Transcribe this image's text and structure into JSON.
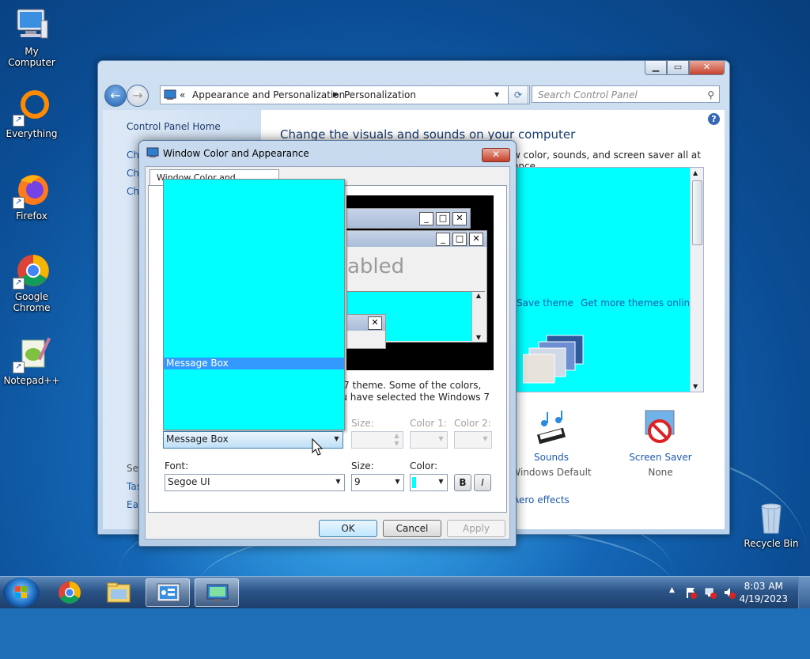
{
  "desktop_icons": [
    {
      "label": "My Computer",
      "icon": "computer-icon"
    },
    {
      "label": "Everything",
      "icon": "everything-icon"
    },
    {
      "label": "Firefox",
      "icon": "firefox-icon"
    },
    {
      "label_line1": "Google",
      "label_line2": "Chrome",
      "icon": "chrome-icon"
    },
    {
      "label": "Notepad++",
      "icon": "notepadpp-icon"
    },
    {
      "label": "Recycle Bin",
      "icon": "recycle-bin-icon"
    }
  ],
  "control_panel": {
    "breadcrumb_prefix": "«",
    "breadcrumb": [
      "Appearance and Personalization",
      "Personalization"
    ],
    "search_placeholder": "Search Control Panel",
    "left_home": "Control Panel Home",
    "left_links_partial": [
      "Ch",
      "Ch",
      "Ch"
    ],
    "see_also_partial": "See",
    "see_also_links_partial": [
      "Tas",
      "Eas"
    ],
    "heading": "Change the visuals and sounds on your computer",
    "subtext_partial": "w color, sounds, and screen saver all at once.",
    "save_theme": "Save theme",
    "get_more_themes": "Get more themes online",
    "sounds_label": "Sounds",
    "sounds_value": "Windows Default",
    "screensaver_label": "Screen Saver",
    "screensaver_value": "None",
    "aero_effects": "Aero effects"
  },
  "dialog": {
    "title": "Window Color and Appearance",
    "tab": "Window Color and Appearance",
    "preview": {
      "inactive_text_partial": "abled",
      "close_glyph": "✕",
      "min_glyph": "_",
      "max_glyph": "□"
    },
    "theme_text_line1": "s 7 theme.  Some of the colors,",
    "theme_text_line2": "ou have selected the Windows 7",
    "item_list_selected": "Message Box",
    "item_combo_value": "Message Box",
    "size_label_top": "Size:",
    "color1_label": "Color 1:",
    "color2_label": "Color 2:",
    "font_label": "Font:",
    "font_value": "Segoe UI",
    "font_size_label": "Size:",
    "font_size_value": "9",
    "font_color_label": "Color:",
    "bold_label": "B",
    "italic_label": "I",
    "ok": "OK",
    "cancel": "Cancel",
    "apply": "Apply",
    "accent_color": "#00ffff"
  },
  "taskbar": {
    "clock_time": "8:03 AM",
    "clock_date": "4/19/2023",
    "tray_arrow": "▲"
  }
}
